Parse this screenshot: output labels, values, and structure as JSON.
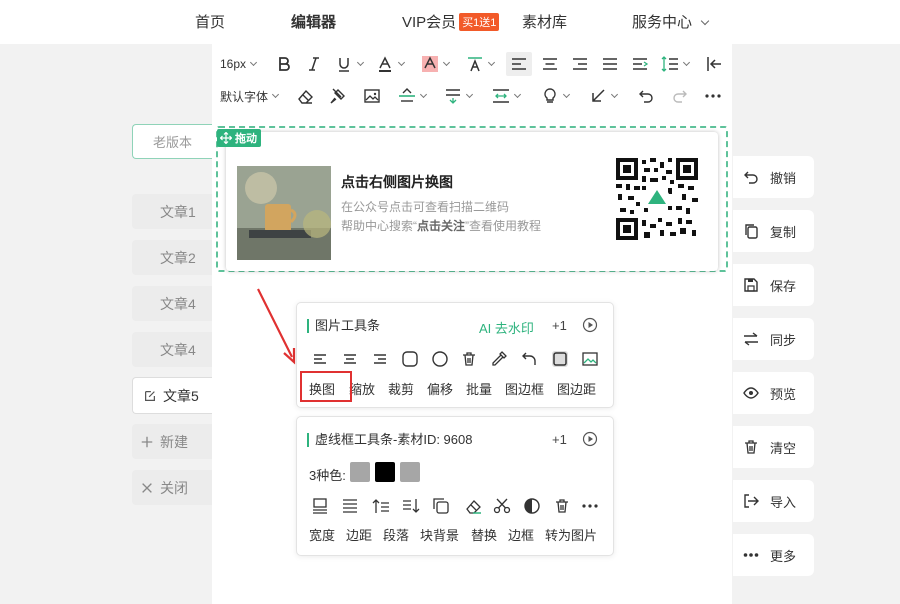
{
  "nav": {
    "home": "首页",
    "editor": "编辑器",
    "vip": "VIP会员",
    "vip_badge": "买1送1",
    "assets": "素材库",
    "service": "服务中心"
  },
  "toolbar": {
    "font_size": "16px",
    "font_family": "默认字体"
  },
  "card": {
    "drag_label": "拖动",
    "title": "点击右侧图片换图",
    "line1": "在公众号点击可查看扫描二维码",
    "line2_prefix": "帮助中心搜索“",
    "line2_bold": "点击关注",
    "line2_suffix": "”查看使用教程"
  },
  "left": {
    "old_version": "老版本",
    "articles": [
      "文章1",
      "文章2",
      "文章4",
      "文章4",
      "文章5"
    ],
    "new": "新建",
    "close": "关闭"
  },
  "right": [
    "撤销",
    "复制",
    "保存",
    "同步",
    "预览",
    "清空",
    "导入",
    "更多"
  ],
  "image_toolbar": {
    "title": "图片工具条",
    "ai": "AI 去水印",
    "plus": "+1",
    "labels": [
      "换图",
      "缩放",
      "裁剪",
      "偏移",
      "批量",
      "图边框",
      "图边距"
    ]
  },
  "frame_toolbar": {
    "title": "虚线框工具条-素材ID: 9608",
    "plus": "+1",
    "colors_label": "3种色:",
    "colors": [
      "#a6a6a6",
      "#000000",
      "#a6a6a6"
    ],
    "labels": [
      "宽度",
      "边距",
      "段落",
      "块背景",
      "替换",
      "边框",
      "转为图片"
    ]
  },
  "accent": "#2eb37e",
  "highlight": "#e03131"
}
